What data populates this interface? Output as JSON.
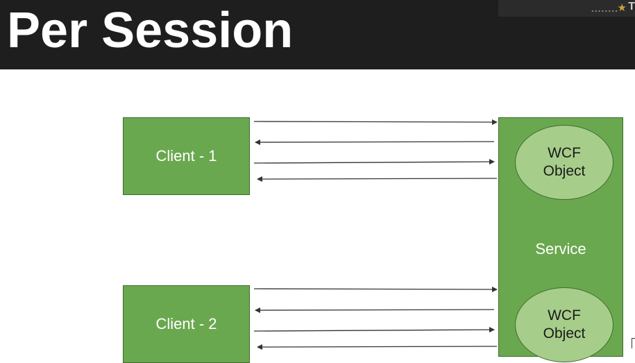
{
  "header": {
    "title": "Per Session",
    "watermark": {
      "dots": "........",
      "icon": "star-icon",
      "letter": "T"
    }
  },
  "diagram": {
    "clients": [
      {
        "label": "Client - 1"
      },
      {
        "label": "Client - 2"
      }
    ],
    "service": {
      "label": "Service",
      "objects": [
        {
          "line1": "WCF",
          "line2": "Object"
        },
        {
          "line1": "WCF",
          "line2": "Object"
        }
      ]
    }
  },
  "colors": {
    "header_bg": "#1e1e1e",
    "box_fill": "#6aa84f",
    "ellipse_fill": "#a6cd8a",
    "arrow": "#333333"
  }
}
